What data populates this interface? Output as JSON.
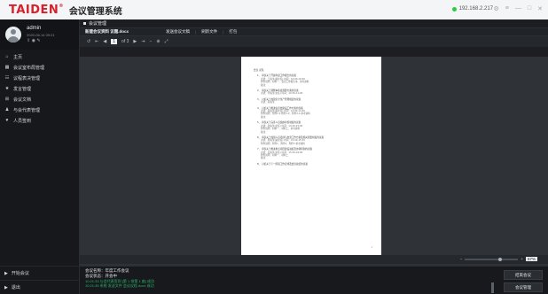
{
  "titlebar": {
    "logo": "TAIDEN",
    "app_title": "会议管理系统",
    "ip": "192.168.2.217",
    "controls": [
      "⚙",
      "≡",
      "—",
      "□",
      "✕"
    ]
  },
  "user": {
    "name": "admin",
    "sub": "2020-06-14 09:21",
    "controls": [
      "⇪",
      "◉",
      "✎"
    ]
  },
  "sidebar": {
    "items": [
      {
        "icon": "⌂",
        "label": "主页"
      },
      {
        "icon": "▦",
        "label": "会议室布局管理"
      },
      {
        "icon": "☷",
        "label": "议程表决管理"
      },
      {
        "icon": "★",
        "label": "发言管理"
      },
      {
        "icon": "⊞",
        "label": "会议文档"
      },
      {
        "icon": "♟",
        "label": "与会代表管理"
      },
      {
        "icon": "♥",
        "label": "人员签到"
      }
    ],
    "bottom": [
      {
        "icon": "▶",
        "label": "开始会议"
      },
      {
        "icon": "▶",
        "label": "退出"
      }
    ]
  },
  "main": {
    "section_title": "会议管理",
    "filebar": {
      "file_label": "新建会议资料 议题.docx",
      "actions": [
        "发送会议文稿",
        "刷新文件",
        "打包"
      ]
    },
    "toolbar": {
      "icons": [
        "↺",
        "⇤",
        "◀",
        "▶",
        "⇥",
        "−",
        "⊕",
        "⤢"
      ],
      "page": "1",
      "page_total": "of 3"
    }
  },
  "document": {
    "lines": [
      {
        "cls": "t1",
        "text": "会议 议程："
      },
      {
        "cls": "main-item gap",
        "text": "1、 审议关于开展年度工作报告的议案"
      },
      {
        "cls": "sub",
        "text": "主讲：王先生(副主任)    时间：10:00-10:30"
      },
      {
        "cls": "sub",
        "text": "附件说明：材料一、会议工作报告书、参考资料"
      },
      {
        "cls": "sub",
        "text": "备注："
      },
      {
        "cls": "main-item gap",
        "text": "2、 审议关于调整本年度预算方案的议案"
      },
      {
        "cls": "sub",
        "text": "主讲：李先生(主任)    时间：10:30-11:00"
      },
      {
        "cls": "main-item gap",
        "text": "3、 讨论关于加强安全生产管理规定的议案"
      },
      {
        "cls": "sub",
        "text": "主讲：陈先生"
      },
      {
        "cls": "main-item gap",
        "text": "4、 讨论关于推进信息化建设工作方案的议案"
      },
      {
        "cls": "sub",
        "text": "主讲：赵先生(副主任)    时间：14:00-14:30"
      },
      {
        "cls": "sub",
        "text": "附件说明：附件1.1-附件1.2、附件3-4 参考资料"
      },
      {
        "cls": "sub",
        "text": "备注："
      },
      {
        "cls": "main-item gap",
        "text": "5、 审议关于完善人员绩效考核制度的议案"
      },
      {
        "cls": "sub",
        "text": "主讲：孙先生(主任)    时间：14:30-15:00"
      },
      {
        "cls": "sub",
        "text": "附件说明：材料一、材料二、参考资料"
      },
      {
        "cls": "sub",
        "text": "备注："
      },
      {
        "cls": "main-item gap",
        "text": "6、 审议关于加强人员培训与交流工作方案及相关配套制度的议案"
      },
      {
        "cls": "sub",
        "text": "主讲：周先生(副主任)    时间：15:00-15:30"
      },
      {
        "cls": "sub",
        "text": "附件说明：附件1、附件2、附件3 参考资料"
      },
      {
        "cls": "main-item gap",
        "text": "7、 审议关于推进重点项目建设进度及协调机制的议案"
      },
      {
        "cls": "sub",
        "text": "主讲：吴先生(主任)    时间：15:30-16:00"
      },
      {
        "cls": "sub",
        "text": "附件说明：材料一、材料二"
      },
      {
        "cls": "sub",
        "text": "备注："
      },
      {
        "cls": "main-item gap",
        "text": "8、 讨论关于下一阶段工作安排及会议总结的议案"
      }
    ],
    "page_num": "1"
  },
  "statusbar": {
    "zoom_level": 0.67,
    "zoom_pct": "67%"
  },
  "bottom_panel": {
    "meeting_name_label": "会议名称：",
    "meeting_name": "年度工作会议",
    "meeting_status_label": "会议状态：",
    "meeting_status": "开会中",
    "log_lines": [
      "10:21:33  与会代表签到 [第 1 排第 1 座] 成功",
      "10:21:35  系统 发送文件 会议议程.docx 成功"
    ],
    "btn1": "结束会议",
    "btn2": "会议管理"
  },
  "colors": {
    "brand": "#d7202b",
    "status_online": "#2ecc40",
    "log_text": "#2bb673"
  }
}
